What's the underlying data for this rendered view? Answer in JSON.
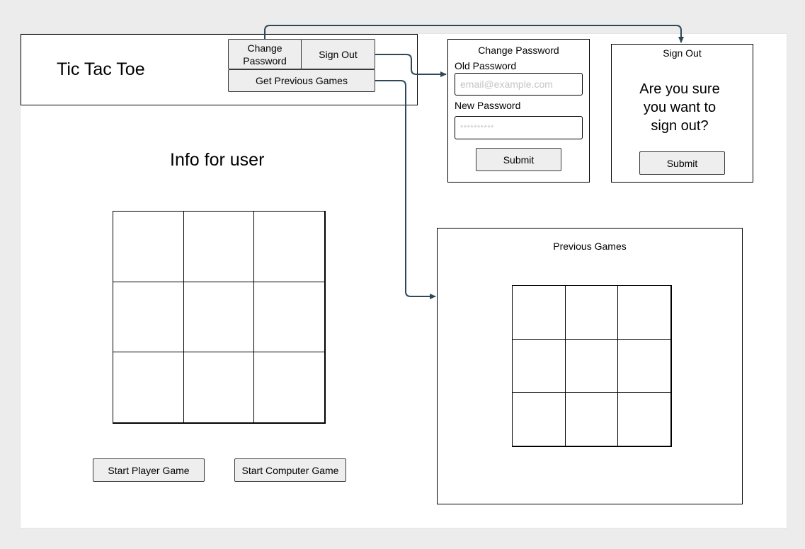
{
  "header": {
    "title": "Tic Tac Toe",
    "change_password_button": "Change Password",
    "sign_out_button": "Sign Out",
    "get_previous_games_button": "Get Previous Games"
  },
  "main": {
    "info_text": "Info for user",
    "board_cells": [
      "",
      "",
      "",
      "",
      "",
      "",
      "",
      "",
      ""
    ],
    "start_player_game_button": "Start Player Game",
    "start_computer_game_button": "Start Computer Game"
  },
  "change_password_panel": {
    "title": "Change Password",
    "old_password_label": "Old Password",
    "old_password_placeholder": "email@example.com",
    "new_password_label": "New Password",
    "new_password_placeholder": "**********",
    "submit_button": "Submit"
  },
  "sign_out_panel": {
    "title": "Sign Out",
    "message": "Are you sure you want to sign out?",
    "submit_button": "Submit"
  },
  "previous_games_panel": {
    "title": "Previous Games",
    "board_cells": [
      "",
      "",
      "",
      "",
      "",
      "",
      "",
      "",
      ""
    ]
  },
  "colors": {
    "connector": "#2f4858",
    "button_fill": "#eeeeee",
    "background": "#ececec"
  }
}
